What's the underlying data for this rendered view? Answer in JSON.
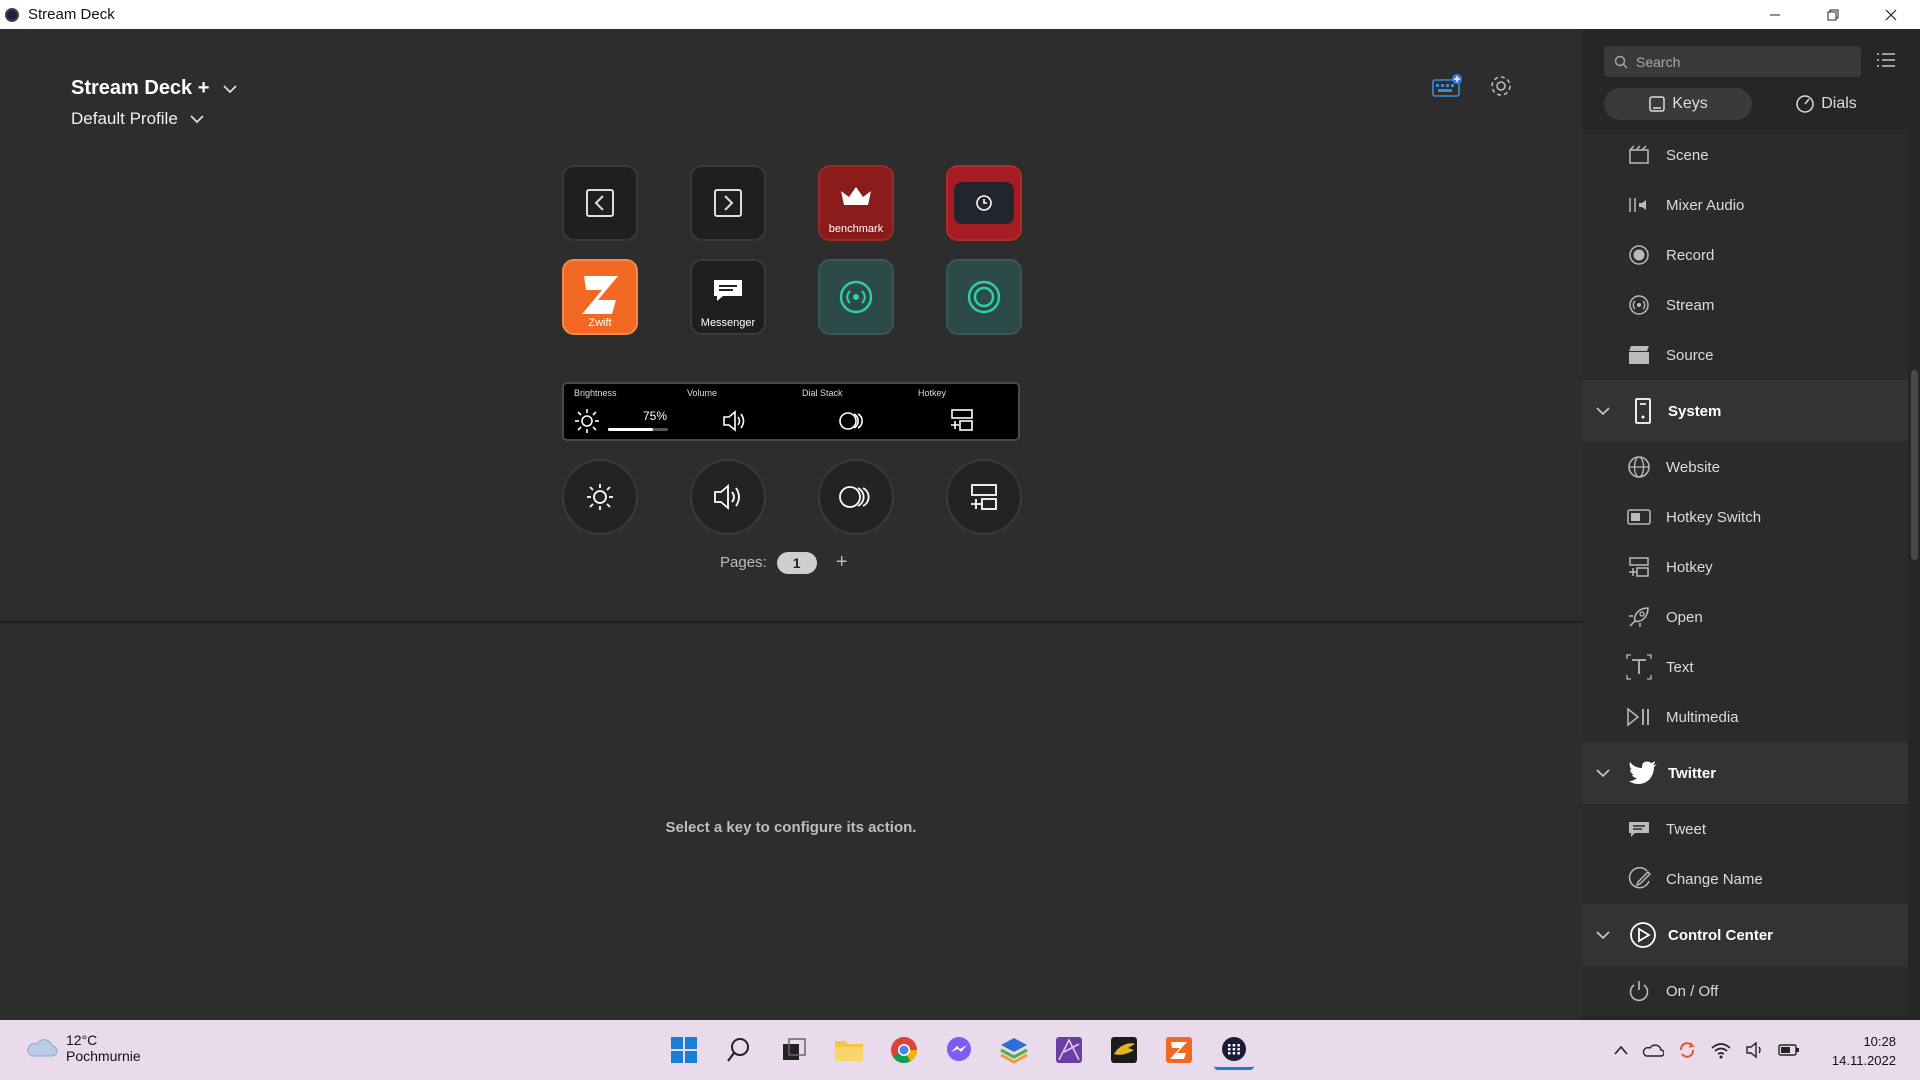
{
  "window": {
    "title": "Stream Deck"
  },
  "header": {
    "device_name": "Stream Deck +",
    "profile_name": "Default Profile"
  },
  "keys": [
    {
      "label": "",
      "icon": "back-arrow-icon"
    },
    {
      "label": "",
      "icon": "forward-arrow-icon"
    },
    {
      "label": "benchmark",
      "icon": "crown-icon",
      "bg": "#8b1a1a"
    },
    {
      "label": "",
      "icon": "elgato-icon",
      "bg": "#a51c22"
    },
    {
      "label": "Zwift",
      "icon": "zwift-icon",
      "bg": "#f26722"
    },
    {
      "label": "Messenger",
      "icon": "chat-icon"
    },
    {
      "label": "",
      "icon": "stream-icon",
      "bg": "#2c4a47"
    },
    {
      "label": "",
      "icon": "record-icon",
      "bg": "#2c4a47"
    }
  ],
  "touch_strip": {
    "brightness_label": "Brightness",
    "brightness_value": "75%",
    "brightness_level": 0.75,
    "volume_label": "Volume",
    "dialstack_label": "Dial Stack",
    "hotkey_label": "Hotkey"
  },
  "pages": {
    "label": "Pages:",
    "current": "1",
    "add": "+"
  },
  "hint": "Select a key to configure its action.",
  "sidebar": {
    "search_placeholder": "Search",
    "tabs": {
      "keys": "Keys",
      "dials": "Dials"
    },
    "items_top": [
      "Scene",
      "Mixer Audio",
      "Record",
      "Stream",
      "Source"
    ],
    "system_label": "System",
    "system_items": [
      "Website",
      "Hotkey Switch",
      "Hotkey",
      "Open",
      "Text",
      "Multimedia"
    ],
    "twitter_label": "Twitter",
    "twitter_items": [
      "Tweet",
      "Change Name"
    ],
    "control_center_label": "Control Center",
    "control_center_items": [
      "On / Off"
    ]
  },
  "taskbar": {
    "temperature": "12°C",
    "weather_desc": "Pochmurnie",
    "time": "10:28",
    "date": "14.11.2022"
  },
  "colors": {
    "accent_teal": "#2bd1a8",
    "zwift_orange": "#f26722"
  }
}
